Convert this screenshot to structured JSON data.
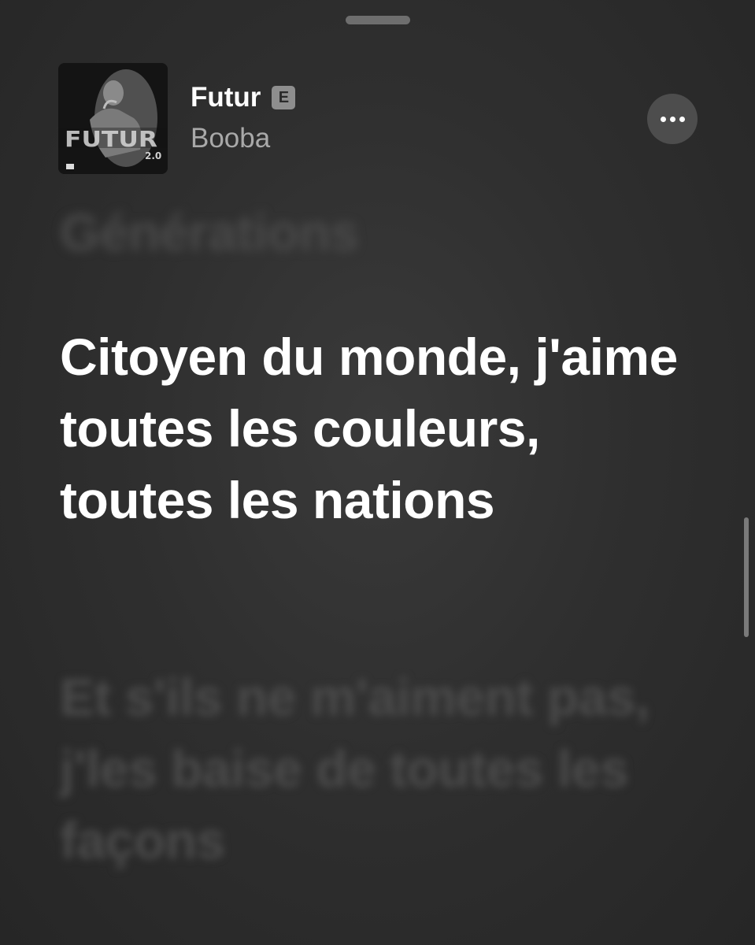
{
  "song": {
    "title": "Futur",
    "explicit_badge": "E",
    "artist": "Booba"
  },
  "artwork": {
    "label": "FUTUR 2.0",
    "icon": "album-artwork"
  },
  "more_button": {
    "icon": "ellipsis-icon"
  },
  "lyrics": {
    "previous": "Générations",
    "active": "Citoyen du monde, j'aime toutes les couleurs, toutes les nations",
    "next": "Et s'ils ne m'aiment pas, j'les baise de toutes les façons"
  },
  "colors": {
    "background": "#2f2f2f",
    "active_lyric": "#ffffff",
    "inactive_lyric": "#4a4a4a",
    "artist": "#a9a9a9"
  }
}
